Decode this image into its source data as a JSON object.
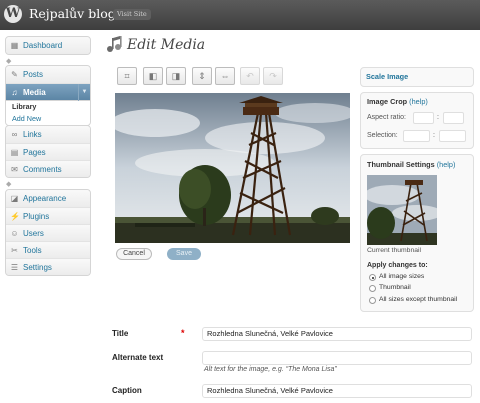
{
  "header": {
    "blog_name": "Rejpalův blog",
    "visit_site": "Visit Site",
    "logo_letter": "W"
  },
  "sidebar": {
    "group1": [
      {
        "label": "Dashboard",
        "icon": "dashboard-icon"
      }
    ],
    "group2": [
      {
        "label": "Posts",
        "icon": "posts-icon"
      },
      {
        "label": "Media",
        "icon": "media-icon",
        "current": true
      },
      {
        "label": "Links",
        "icon": "links-icon"
      },
      {
        "label": "Pages",
        "icon": "pages-icon"
      },
      {
        "label": "Comments",
        "icon": "comments-icon"
      }
    ],
    "media_submenu": [
      {
        "label": "Library",
        "active": true
      },
      {
        "label": "Add New"
      }
    ],
    "group3": [
      {
        "label": "Appearance",
        "icon": "appearance-icon"
      },
      {
        "label": "Plugins",
        "icon": "plugins-icon"
      },
      {
        "label": "Users",
        "icon": "users-icon"
      },
      {
        "label": "Tools",
        "icon": "tools-icon"
      },
      {
        "label": "Settings",
        "icon": "settings-icon"
      }
    ]
  },
  "page": {
    "title": "Edit Media"
  },
  "toolbar": {
    "buttons": [
      "crop-icon",
      "rotate-left-icon",
      "rotate-right-icon",
      "flip-vertical-icon",
      "flip-horizontal-icon",
      "undo-icon",
      "redo-icon"
    ]
  },
  "editor": {
    "cancel_label": "Cancel",
    "save_label": "Save"
  },
  "scale_panel": {
    "title": "Scale Image"
  },
  "crop_panel": {
    "title": "Image Crop",
    "help": "(help)",
    "aspect_label": "Aspect ratio:",
    "selection_label": "Selection:",
    "separator": ":"
  },
  "thumb_panel": {
    "title": "Thumbnail Settings",
    "help": "(help)",
    "caption": "Current thumbnail",
    "apply_label": "Apply changes to:",
    "options": [
      {
        "label": "All image sizes",
        "checked": true
      },
      {
        "label": "Thumbnail",
        "checked": false
      },
      {
        "label": "All sizes except thumbnail",
        "checked": false
      }
    ]
  },
  "form": {
    "title_label": "Title",
    "required_mark": "*",
    "title_value": "Rozhledna Slunečná, Velké Pavlovice",
    "alt_label": "Alternate text",
    "alt_value": "",
    "alt_hint": "Alt text for the image, e.g. “The Mona Lisa”",
    "caption_label": "Caption",
    "caption_value": "Rozhledna Slunečná, Velké Pavlovice"
  }
}
